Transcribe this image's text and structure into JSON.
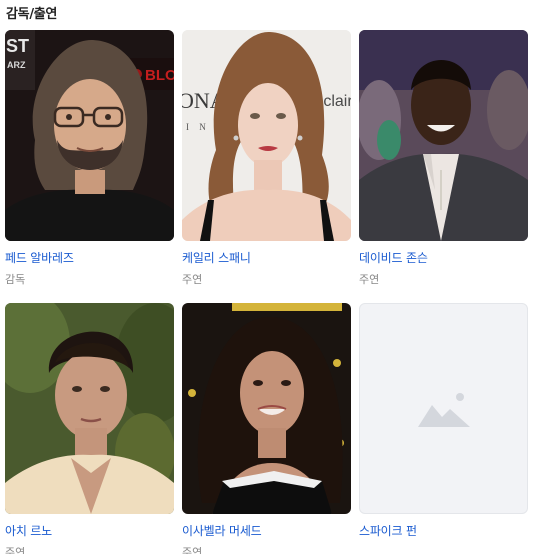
{
  "section": {
    "title": "감독/출연"
  },
  "people": [
    {
      "name": "페드 알바레즈",
      "role": "감독",
      "has_photo": true
    },
    {
      "name": "케일리 스패니",
      "role": "주연",
      "has_photo": true
    },
    {
      "name": "데이비드 존슨",
      "role": "주연",
      "has_photo": true
    },
    {
      "name": "아치 르노",
      "role": "주연",
      "has_photo": true
    },
    {
      "name": "이사벨라 머세드",
      "role": "주연",
      "has_photo": true
    },
    {
      "name": "스파이크 펀",
      "role": "",
      "has_photo": false
    }
  ],
  "photo_backdrop_text": {
    "card1_left": "ST",
    "card1_left_small": "ARZ",
    "card1_right": "BLO",
    "card2_left": "ONA",
    "card2_left_small": "I N",
    "card2_right": "e clair"
  }
}
